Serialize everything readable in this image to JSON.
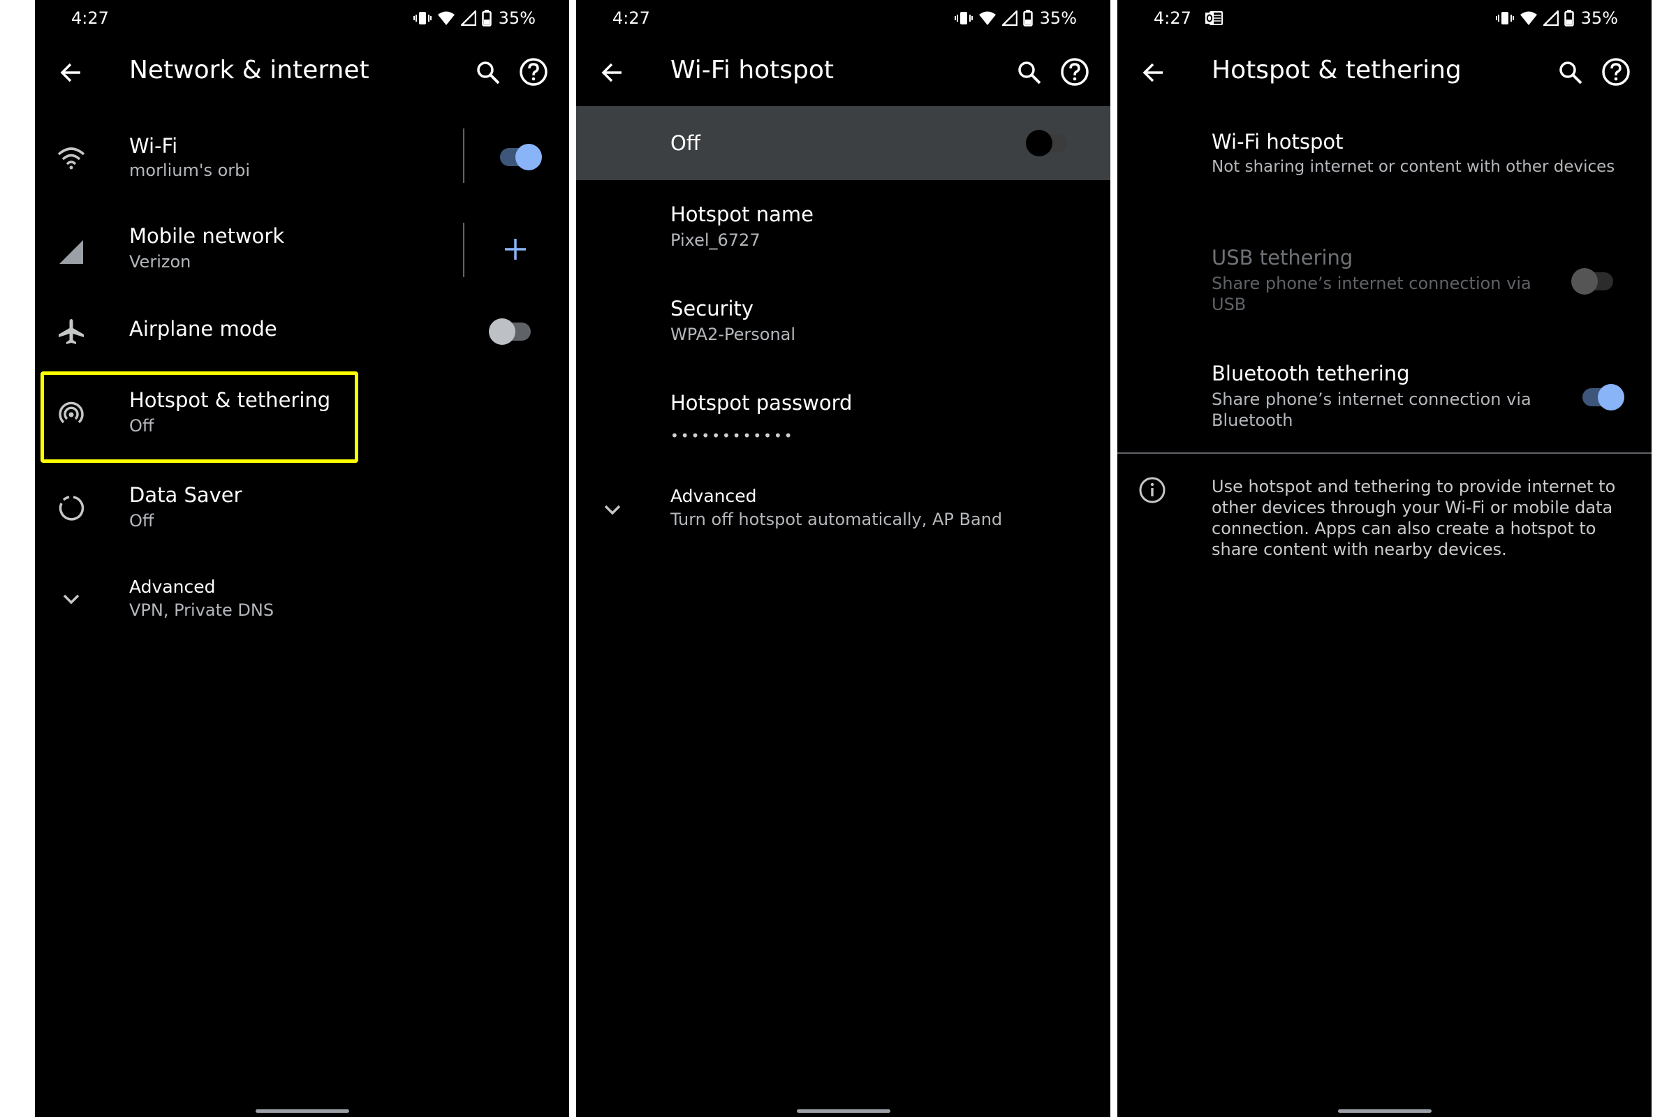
{
  "colors": {
    "accent": "#8ab4f8",
    "highlight": "#ffff00",
    "background": "#000000",
    "banner": "#3c4043"
  },
  "screen1": {
    "status": {
      "time": "4:27",
      "battery": "35%"
    },
    "title": "Network & internet",
    "items": [
      {
        "title": "Wi-Fi",
        "subtitle": "morlium's orbi",
        "icon": "wifi-icon",
        "toggle": "on"
      },
      {
        "title": "Mobile network",
        "subtitle": "Verizon",
        "icon": "signal-icon",
        "action": "add-icon"
      },
      {
        "title": "Airplane mode",
        "icon": "airplane-icon",
        "toggle": "off"
      },
      {
        "title": "Hotspot & tethering",
        "subtitle": "Off",
        "icon": "hotspot-icon",
        "highlighted": true
      },
      {
        "title": "Data Saver",
        "subtitle": "Off",
        "icon": "data-saver-icon"
      },
      {
        "title": "Advanced",
        "subtitle": "VPN, Private DNS",
        "icon": "chevron-down-icon"
      }
    ]
  },
  "screen2": {
    "status": {
      "time": "4:27",
      "battery": "35%"
    },
    "title": "Wi-Fi hotspot",
    "master": {
      "label": "Off",
      "toggle": "off"
    },
    "items": [
      {
        "title": "Hotspot name",
        "subtitle": "Pixel_6727"
      },
      {
        "title": "Security",
        "subtitle": "WPA2-Personal"
      },
      {
        "title": "Hotspot password",
        "subtitle": "••••••••••••"
      },
      {
        "title": "Advanced",
        "subtitle": "Turn off hotspot automatically, AP Band",
        "icon": "chevron-down-icon"
      }
    ]
  },
  "screen3": {
    "status": {
      "time": "4:27",
      "battery": "35%"
    },
    "title": "Hotspot & tethering",
    "items": [
      {
        "title": "Wi-Fi hotspot",
        "subtitle": "Not sharing internet or content with other devices"
      },
      {
        "title": "USB tethering",
        "subtitle_line1": "Share phone’s internet connection via",
        "subtitle_line2": "USB",
        "toggle": "disabled"
      },
      {
        "title": "Bluetooth tethering",
        "subtitle_line1": "Share phone’s internet connection via",
        "subtitle_line2": "Bluetooth",
        "toggle": "on"
      }
    ],
    "info": "Use hotspot and tethering to provide internet to other devices through your Wi-Fi or mobile data connection. Apps can also create a hotspot to share content with nearby devices."
  }
}
